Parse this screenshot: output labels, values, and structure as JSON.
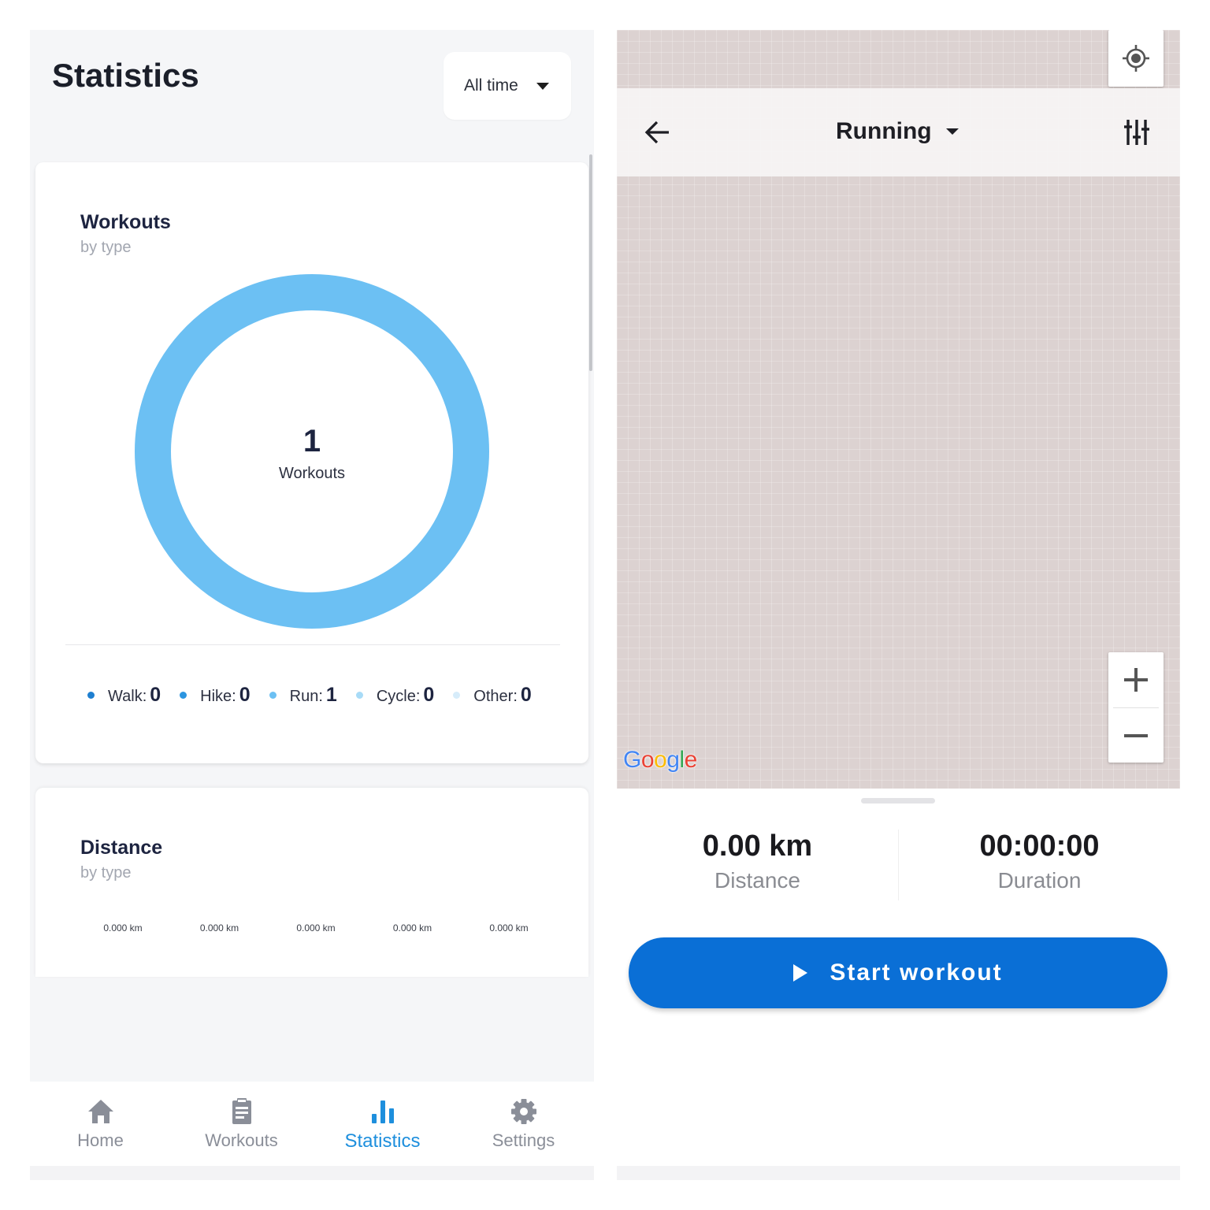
{
  "statistics": {
    "title": "Statistics",
    "range": {
      "selected": "All time"
    },
    "workouts_card": {
      "title": "Workouts",
      "subtitle": "by type",
      "total": "1",
      "total_label": "Workouts",
      "legend": [
        {
          "name": "Walk:",
          "value": "0",
          "color": "#1e7fd0"
        },
        {
          "name": "Hike:",
          "value": "0",
          "color": "#2c95e0"
        },
        {
          "name": "Run:",
          "value": "1",
          "color": "#6cc0f3"
        },
        {
          "name": "Cycle:",
          "value": "0",
          "color": "#a8dbf7"
        },
        {
          "name": "Other:",
          "value": "0",
          "color": "#d6ecfa"
        }
      ]
    },
    "distance_card": {
      "title": "Distance",
      "subtitle": "by type",
      "ticks": [
        "0.000 km",
        "0.000 km",
        "0.000 km",
        "0.000 km",
        "0.000 km"
      ]
    },
    "nav": [
      {
        "label": "Home",
        "icon": "home-icon",
        "active": false
      },
      {
        "label": "Workouts",
        "icon": "clipboard-icon",
        "active": false
      },
      {
        "label": "Statistics",
        "icon": "bar-chart-icon",
        "active": true
      },
      {
        "label": "Settings",
        "icon": "gear-icon",
        "active": false
      }
    ]
  },
  "chart_data": {
    "type": "pie",
    "categories": [
      "Walk",
      "Hike",
      "Run",
      "Cycle",
      "Other"
    ],
    "values": [
      0,
      0,
      1,
      0,
      0
    ],
    "colors": [
      "#1e7fd0",
      "#2c95e0",
      "#6cc0f3",
      "#a8dbf7",
      "#d6ecfa"
    ]
  },
  "workout": {
    "activity": "Running",
    "map_logo": "Google",
    "distance_value": "0.00 km",
    "distance_label": "Distance",
    "duration_value": "00:00:00",
    "duration_label": "Duration",
    "start_label": "Start workout",
    "accent_color": "#0a6fd6"
  }
}
